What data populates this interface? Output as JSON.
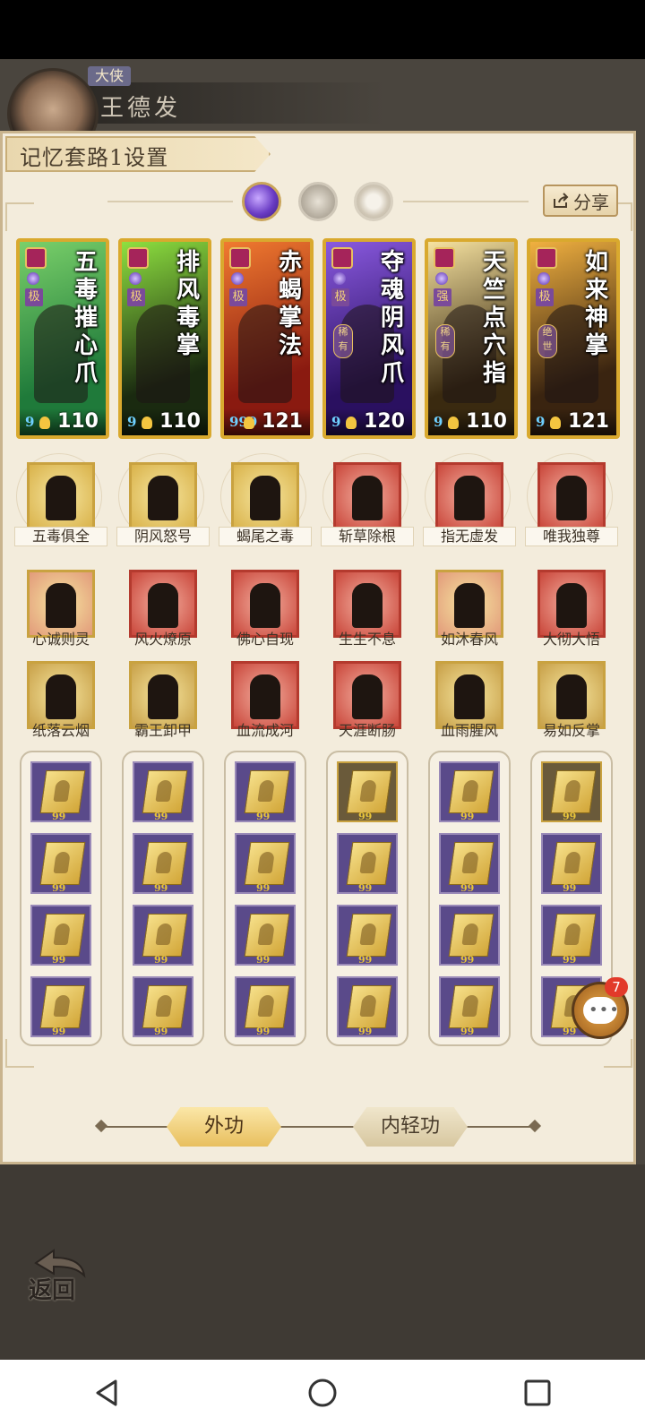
{
  "hero": {
    "rank": "大侠",
    "name": "王德发"
  },
  "panel": {
    "title": "记忆套路1设置",
    "share_label": "分享"
  },
  "cards": [
    {
      "name": "五毒摧心爪",
      "tier": "极",
      "badge": "",
      "gems": "9",
      "value": "110",
      "colors": [
        "#1f7a3a",
        "#7ad06a"
      ]
    },
    {
      "name": "排风毒掌",
      "tier": "极",
      "badge": "",
      "gems": "9",
      "value": "110",
      "colors": [
        "#1a2a10",
        "#8ee040"
      ]
    },
    {
      "name": "赤蝎掌法",
      "tier": "极",
      "badge": "",
      "gems": "999",
      "value": "121",
      "colors": [
        "#8a1a10",
        "#f07a30"
      ]
    },
    {
      "name": "夺魂阴风爪",
      "tier": "极",
      "badge": "稀有",
      "gems": "9",
      "value": "120",
      "colors": [
        "#2a1060",
        "#8a5ae0"
      ]
    },
    {
      "name": "天竺点穴指",
      "tier": "强",
      "badge": "稀有",
      "gems": "9",
      "value": "110",
      "colors": [
        "#3a2a10",
        "#f6e2a0"
      ]
    },
    {
      "name": "如来神掌",
      "tier": "极",
      "badge": "绝世",
      "gems": "9",
      "value": "121",
      "colors": [
        "#3a2410",
        "#f0b040"
      ]
    }
  ],
  "skill_rows": [
    {
      "labels": [
        "五毒俱全",
        "阴风怒号",
        "蝎尾之毒",
        "斩草除根",
        "指无虚发",
        "唯我独尊"
      ]
    },
    {
      "labels": [
        "心诚则灵",
        "风火燎原",
        "佛心自现",
        "生生不息",
        "如沐春风",
        "大彻大悟"
      ]
    },
    {
      "labels": [
        "纸落云烟",
        "霸王卸甲",
        "血流成河",
        "天涯断肠",
        "血雨腥风",
        "易如反掌"
      ]
    }
  ],
  "book_level": "99",
  "chat": {
    "count": "7"
  },
  "tabs": {
    "active": "外功",
    "inactive": "内轻功"
  },
  "back_label": "返回"
}
